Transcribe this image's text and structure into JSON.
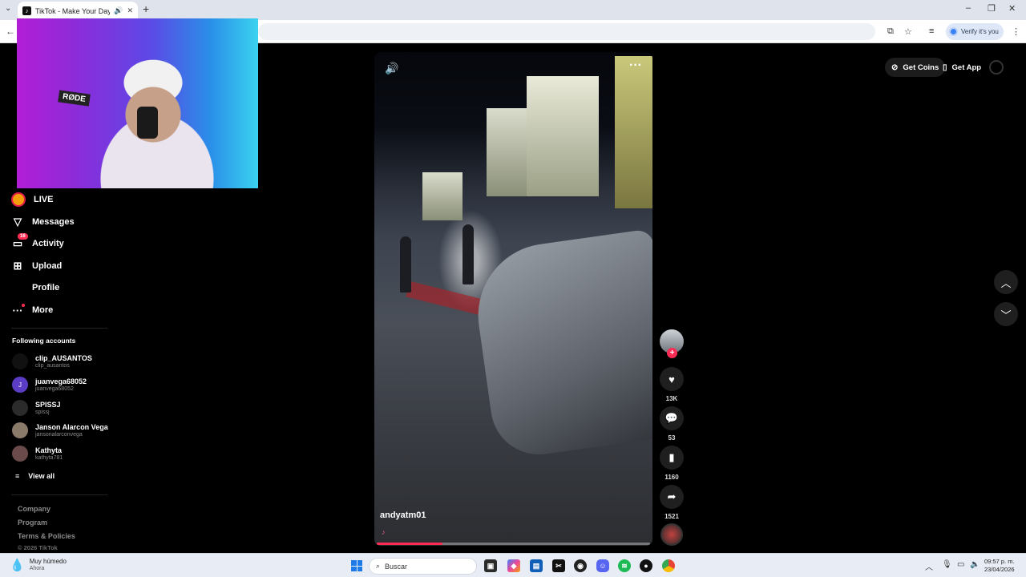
{
  "browser": {
    "tab_title": "TikTok - Make Your Day",
    "verify_label": "Verify it's you"
  },
  "webcam": {
    "mic_brand": "RØDE"
  },
  "sidebar": {
    "items": [
      {
        "label": "LIVE",
        "icon": "live-icon"
      },
      {
        "label": "Messages",
        "icon": "messages-icon"
      },
      {
        "label": "Activity",
        "icon": "activity-icon",
        "badge": "16"
      },
      {
        "label": "Upload",
        "icon": "upload-icon"
      },
      {
        "label": "Profile",
        "icon": "profile-icon"
      },
      {
        "label": "More",
        "icon": "more-icon"
      }
    ],
    "following_title": "Following accounts",
    "accounts": [
      {
        "name": "clip_AUSANTOS",
        "username": "clip_ausantos"
      },
      {
        "name": "juanvega68052",
        "username": "juanvega68052",
        "initial": "J"
      },
      {
        "name": "SPISSJ",
        "username": "spissj"
      },
      {
        "name": "Janson Alarcon Vega",
        "username": "jansonalarconvega"
      },
      {
        "name": "Kathyta",
        "username": "kathyta781"
      }
    ],
    "view_all": "View all",
    "footer_links": [
      "Company",
      "Program",
      "Terms & Policies"
    ],
    "copyright": "© 2026 TikTok"
  },
  "video": {
    "author": "andyatm01",
    "progress": 0.24,
    "likes": "13K",
    "comments": "53",
    "saves": "1160",
    "shares": "1521"
  },
  "topbar": {
    "get_coins": "Get Coins",
    "get_app": "Get App"
  },
  "taskbar": {
    "weather_title": "Muy húmedo",
    "weather_sub": "Ahora",
    "search_placeholder": "Buscar",
    "time": "09:57 p. m.",
    "date": "23/04/2026"
  },
  "colors": {
    "accent": "#fe2c55",
    "background": "#000000"
  }
}
